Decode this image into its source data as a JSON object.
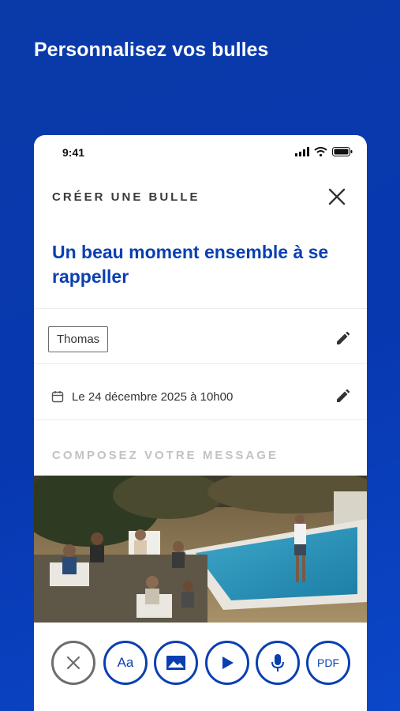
{
  "headline": "Personnalisez vos bulles",
  "status_bar": {
    "time": "9:41",
    "icons": [
      "signal-icon",
      "wifi-icon",
      "battery-icon"
    ]
  },
  "header": {
    "title": "CRÉER UNE BULLE",
    "close_icon": "close-icon"
  },
  "bubble": {
    "title": "Un beau moment ensemble à se rappeller"
  },
  "recipient": {
    "name": "Thomas",
    "edit_icon": "pencil-icon"
  },
  "schedule": {
    "date_text": "Le 24 décembre 2025 à 10h00",
    "calendar_icon": "calendar-icon",
    "edit_icon": "pencil-icon"
  },
  "compose": {
    "label": "COMPOSEZ VOTRE MESSAGE"
  },
  "toolbar": {
    "buttons": [
      {
        "name": "remove",
        "icon": "close-icon",
        "label": ""
      },
      {
        "name": "text",
        "icon": "text-icon",
        "label": "Aa"
      },
      {
        "name": "image",
        "icon": "image-icon",
        "label": ""
      },
      {
        "name": "video",
        "icon": "play-icon",
        "label": ""
      },
      {
        "name": "audio",
        "icon": "microphone-icon",
        "label": ""
      },
      {
        "name": "pdf",
        "icon": "pdf-icon",
        "label": "PDF"
      }
    ]
  },
  "colors": {
    "brand_blue": "#0a3fb2",
    "background": "#0838b0",
    "muted": "#c2c2c2"
  }
}
